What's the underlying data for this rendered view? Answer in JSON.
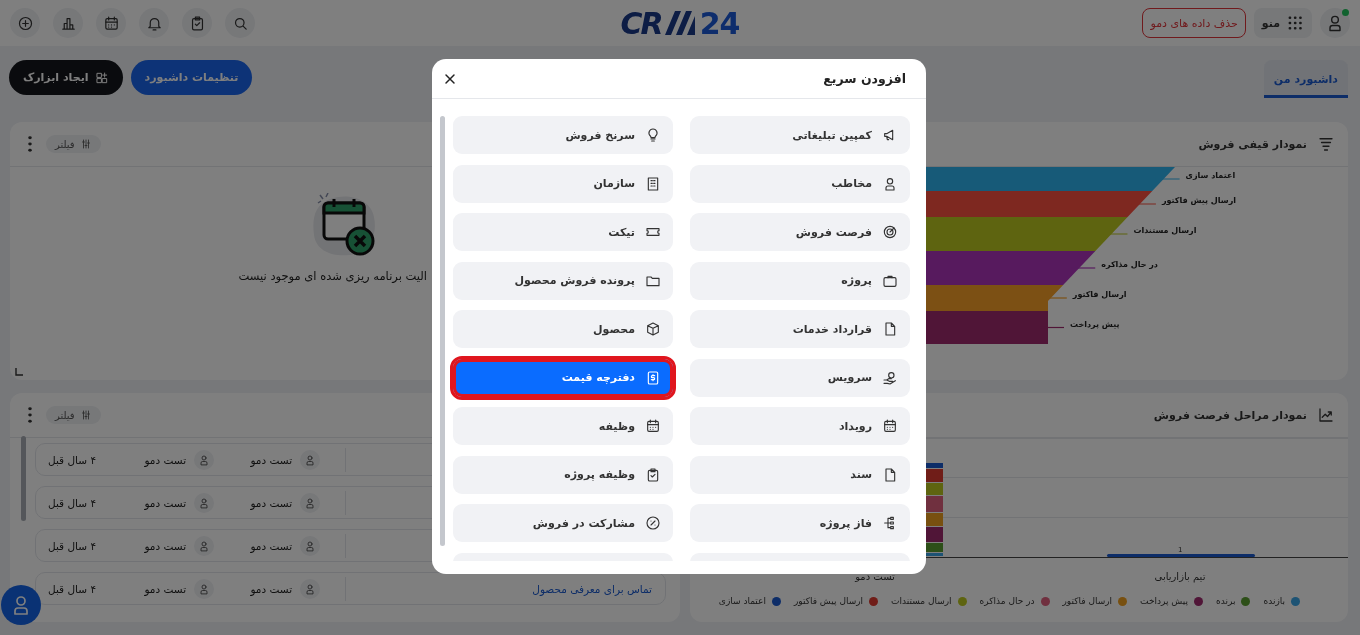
{
  "topbar": {
    "delete_demo_button": "حذف داده های دمو",
    "menu_label": "منو",
    "logo": {
      "lead": "CR",
      "tail": "24"
    }
  },
  "tabs": [
    {
      "label": "داشبورد من",
      "selected": true
    }
  ],
  "toolbar_buttons": [
    {
      "label": "تنظیمات داشبورد",
      "kind": "primary"
    },
    {
      "label": "ایجاد ابزارک",
      "kind": "dark"
    }
  ],
  "funnel_card": {
    "title": "نمودار قیفی فروش",
    "stages": [
      {
        "label": "اعتماد سازی",
        "color": "#175a78"
      },
      {
        "label": "ارسال پیش فاکتور",
        "color": "#7e2820"
      },
      {
        "label": "ارسال مستندات",
        "color": "#5e6410"
      },
      {
        "label": "در حال مذاکره",
        "color": "#571a5e"
      },
      {
        "label": "ارسال فاکتور",
        "color": "#7c5014"
      },
      {
        "label": "پیش پرداخت",
        "color": "#501537"
      }
    ]
  },
  "empty_card": {
    "filter_label": "فیلتر",
    "message": "الیت برنامه ریزی شده ای موجود نیست"
  },
  "activity_card": {
    "filter_label": "فیلتر",
    "rows": [
      {
        "people": [
          "تست دمو",
          "تست دمو"
        ],
        "time": "۴ سال قبل"
      },
      {
        "people": [
          "تست دمو",
          "تست دمو"
        ],
        "time": "۴ سال قبل"
      },
      {
        "people": [
          "تست دمو",
          "تست دمو"
        ],
        "time": "۴ سال قبل"
      },
      {
        "title": "تماس برای معرفی محصول",
        "people": [
          "تست دمو",
          "تست دمو"
        ],
        "time": "۴ سال قبل"
      }
    ]
  },
  "stages_card": {
    "title": "نمودار مراحل فرصت فروش",
    "bar_value": "1",
    "categories": [
      "تیم بازاریابی",
      "تست دمو"
    ],
    "legend": [
      {
        "label": "بازنده",
        "color": "#1d5374"
      },
      {
        "label": "برنده",
        "color": "#2d4f18"
      },
      {
        "label": "پیش پرداخت",
        "color": "#501537"
      },
      {
        "label": "ارسال فاکتور",
        "color": "#785010"
      },
      {
        "label": "در حال مذاکره",
        "color": "#70303f"
      },
      {
        "label": "ارسال مستندات",
        "color": "#5e6410"
      },
      {
        "label": "ارسال پیش فاکتور",
        "color": "#701d18"
      },
      {
        "label": "اعتماد سازی",
        "color": "#0d2d68"
      }
    ]
  },
  "modal": {
    "title": "افزودن سریع",
    "items": [
      {
        "label": "کمپین تبلیغاتی",
        "selected": false
      },
      {
        "label": "سرنخ فروش",
        "selected": false
      },
      {
        "label": "مخاطب",
        "selected": false
      },
      {
        "label": "سازمان",
        "selected": false
      },
      {
        "label": "فرصت فروش",
        "selected": false
      },
      {
        "label": "تیکت",
        "selected": false
      },
      {
        "label": "پروژه",
        "selected": false
      },
      {
        "label": "پرونده فروش محصول",
        "selected": false
      },
      {
        "label": "قرارداد خدمات",
        "selected": false
      },
      {
        "label": "محصول",
        "selected": false
      },
      {
        "label": "سرویس",
        "selected": false
      },
      {
        "label": "دفترچه قیمت",
        "selected": true
      },
      {
        "label": "رویداد",
        "selected": false
      },
      {
        "label": "وظیفه",
        "selected": false
      },
      {
        "label": "سند",
        "selected": false
      },
      {
        "label": "وظیفه پروژه",
        "selected": false
      },
      {
        "label": "فاز پروژه",
        "selected": false
      },
      {
        "label": "مشارکت در فروش",
        "selected": false
      }
    ]
  }
}
